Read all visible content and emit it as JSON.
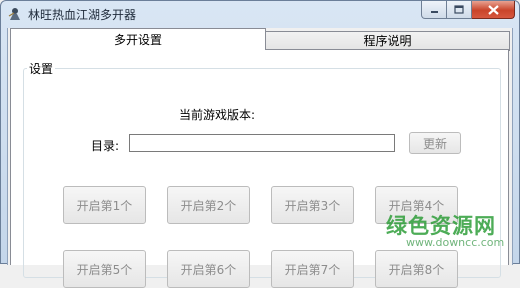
{
  "window": {
    "title": "林旺热血江湖多开器",
    "icon": "game-character-icon",
    "buttons": {
      "minimize": "minimize-icon",
      "maximize": "maximize-icon",
      "close": "close-icon"
    }
  },
  "tabs": [
    {
      "label": "多开设置",
      "active": true
    },
    {
      "label": "程序说明",
      "active": false
    }
  ],
  "settings": {
    "group_label": "设置",
    "version_label": "当前游戏版本:",
    "dir_label": "目录:",
    "dir_value": "",
    "update_button": "更新"
  },
  "open_buttons": [
    "开启第1个",
    "开启第2个",
    "开启第3个",
    "开启第4个",
    "开启第5个",
    "开启第6个",
    "开启第7个",
    "开启第8个"
  ],
  "watermark": {
    "text": "绿色资源网",
    "sub": "www.downcc.com"
  },
  "colors": {
    "title_bar": "#c4d6ea",
    "close_button": "#c9442a",
    "watermark": "#2f9e3a"
  }
}
